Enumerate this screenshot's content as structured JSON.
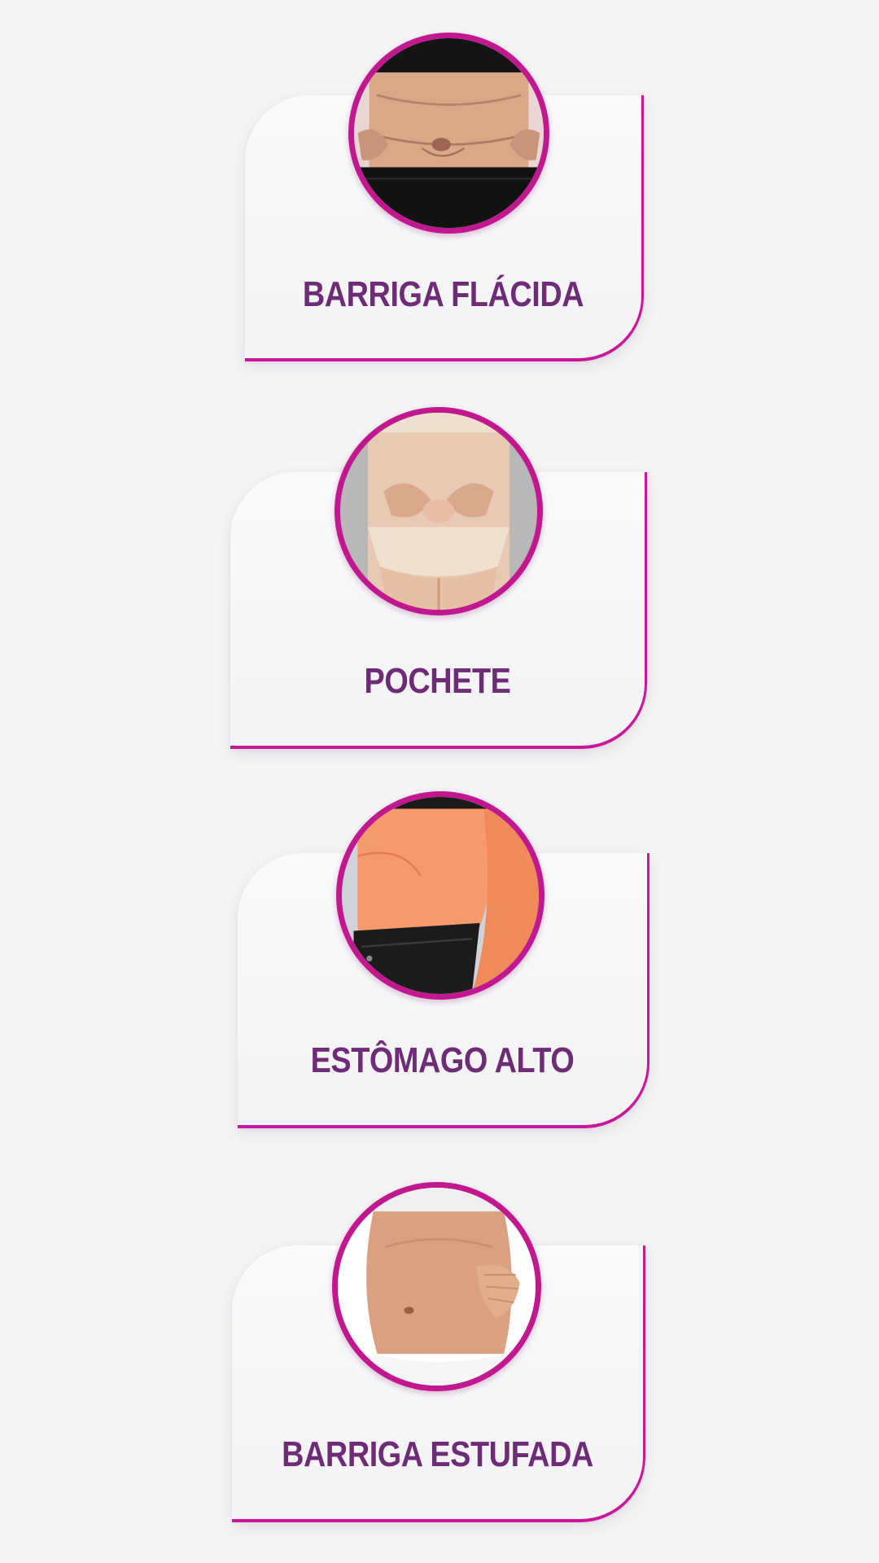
{
  "cards": [
    {
      "label": "BARRIGA FLÁCIDA",
      "image_icon": "loose-belly-photo-icon"
    },
    {
      "label": "POCHETE",
      "image_icon": "lower-belly-fat-photo-icon"
    },
    {
      "label": "ESTÔMAGO ALTO",
      "image_icon": "upper-stomach-photo-icon"
    },
    {
      "label": "BARRIGA ESTUFADA",
      "image_icon": "bloated-belly-photo-icon"
    }
  ],
  "colors": {
    "background": "#f4f4f5",
    "accent": "#c8179a",
    "label": "#6e2c77"
  }
}
